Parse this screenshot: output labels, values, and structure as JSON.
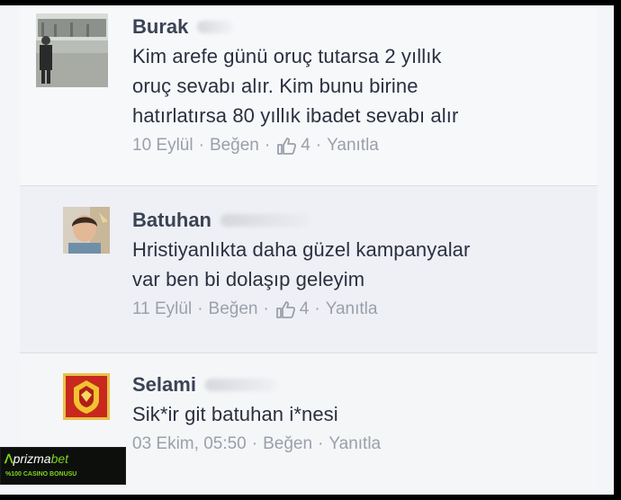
{
  "comments": [
    {
      "name": "Burak",
      "text_lines": [
        "Kim arefe günü oruç tutarsa 2 yıllık",
        "oruç sevabı alır. Kim bunu birine",
        "hatırlatırsa 80 yıllık ibadet sevabı alır"
      ],
      "date": "10 Eylül",
      "like_label": "Beğen",
      "like_count": "4",
      "reply_label": "Yanıtla",
      "sep": "·"
    },
    {
      "name": "Batuhan",
      "text_lines": [
        "Hristiyanlıkta daha güzel kampanyalar",
        "var ben bi dolaşıp geleyim"
      ],
      "date": "11 Eylül",
      "like_label": "Beğen",
      "like_count": "4",
      "reply_label": "Yanıtla",
      "sep": "·"
    },
    {
      "name": "Selami",
      "text_lines": [
        "Sik*ir git batuhan i*nesi"
      ],
      "date": "03 Ekim, 05:50",
      "like_label": "Beğen",
      "reply_label": "Yanıtla",
      "sep": "·"
    }
  ],
  "watermark": {
    "brand_prefix": "prizma",
    "brand_suffix": "bet",
    "tagline": "%100 CASINO BONUSU"
  },
  "colors": {
    "name": "#3b4354",
    "text": "#2b3040",
    "meta": "#9aa0aa",
    "brand_green": "#7ed321"
  }
}
